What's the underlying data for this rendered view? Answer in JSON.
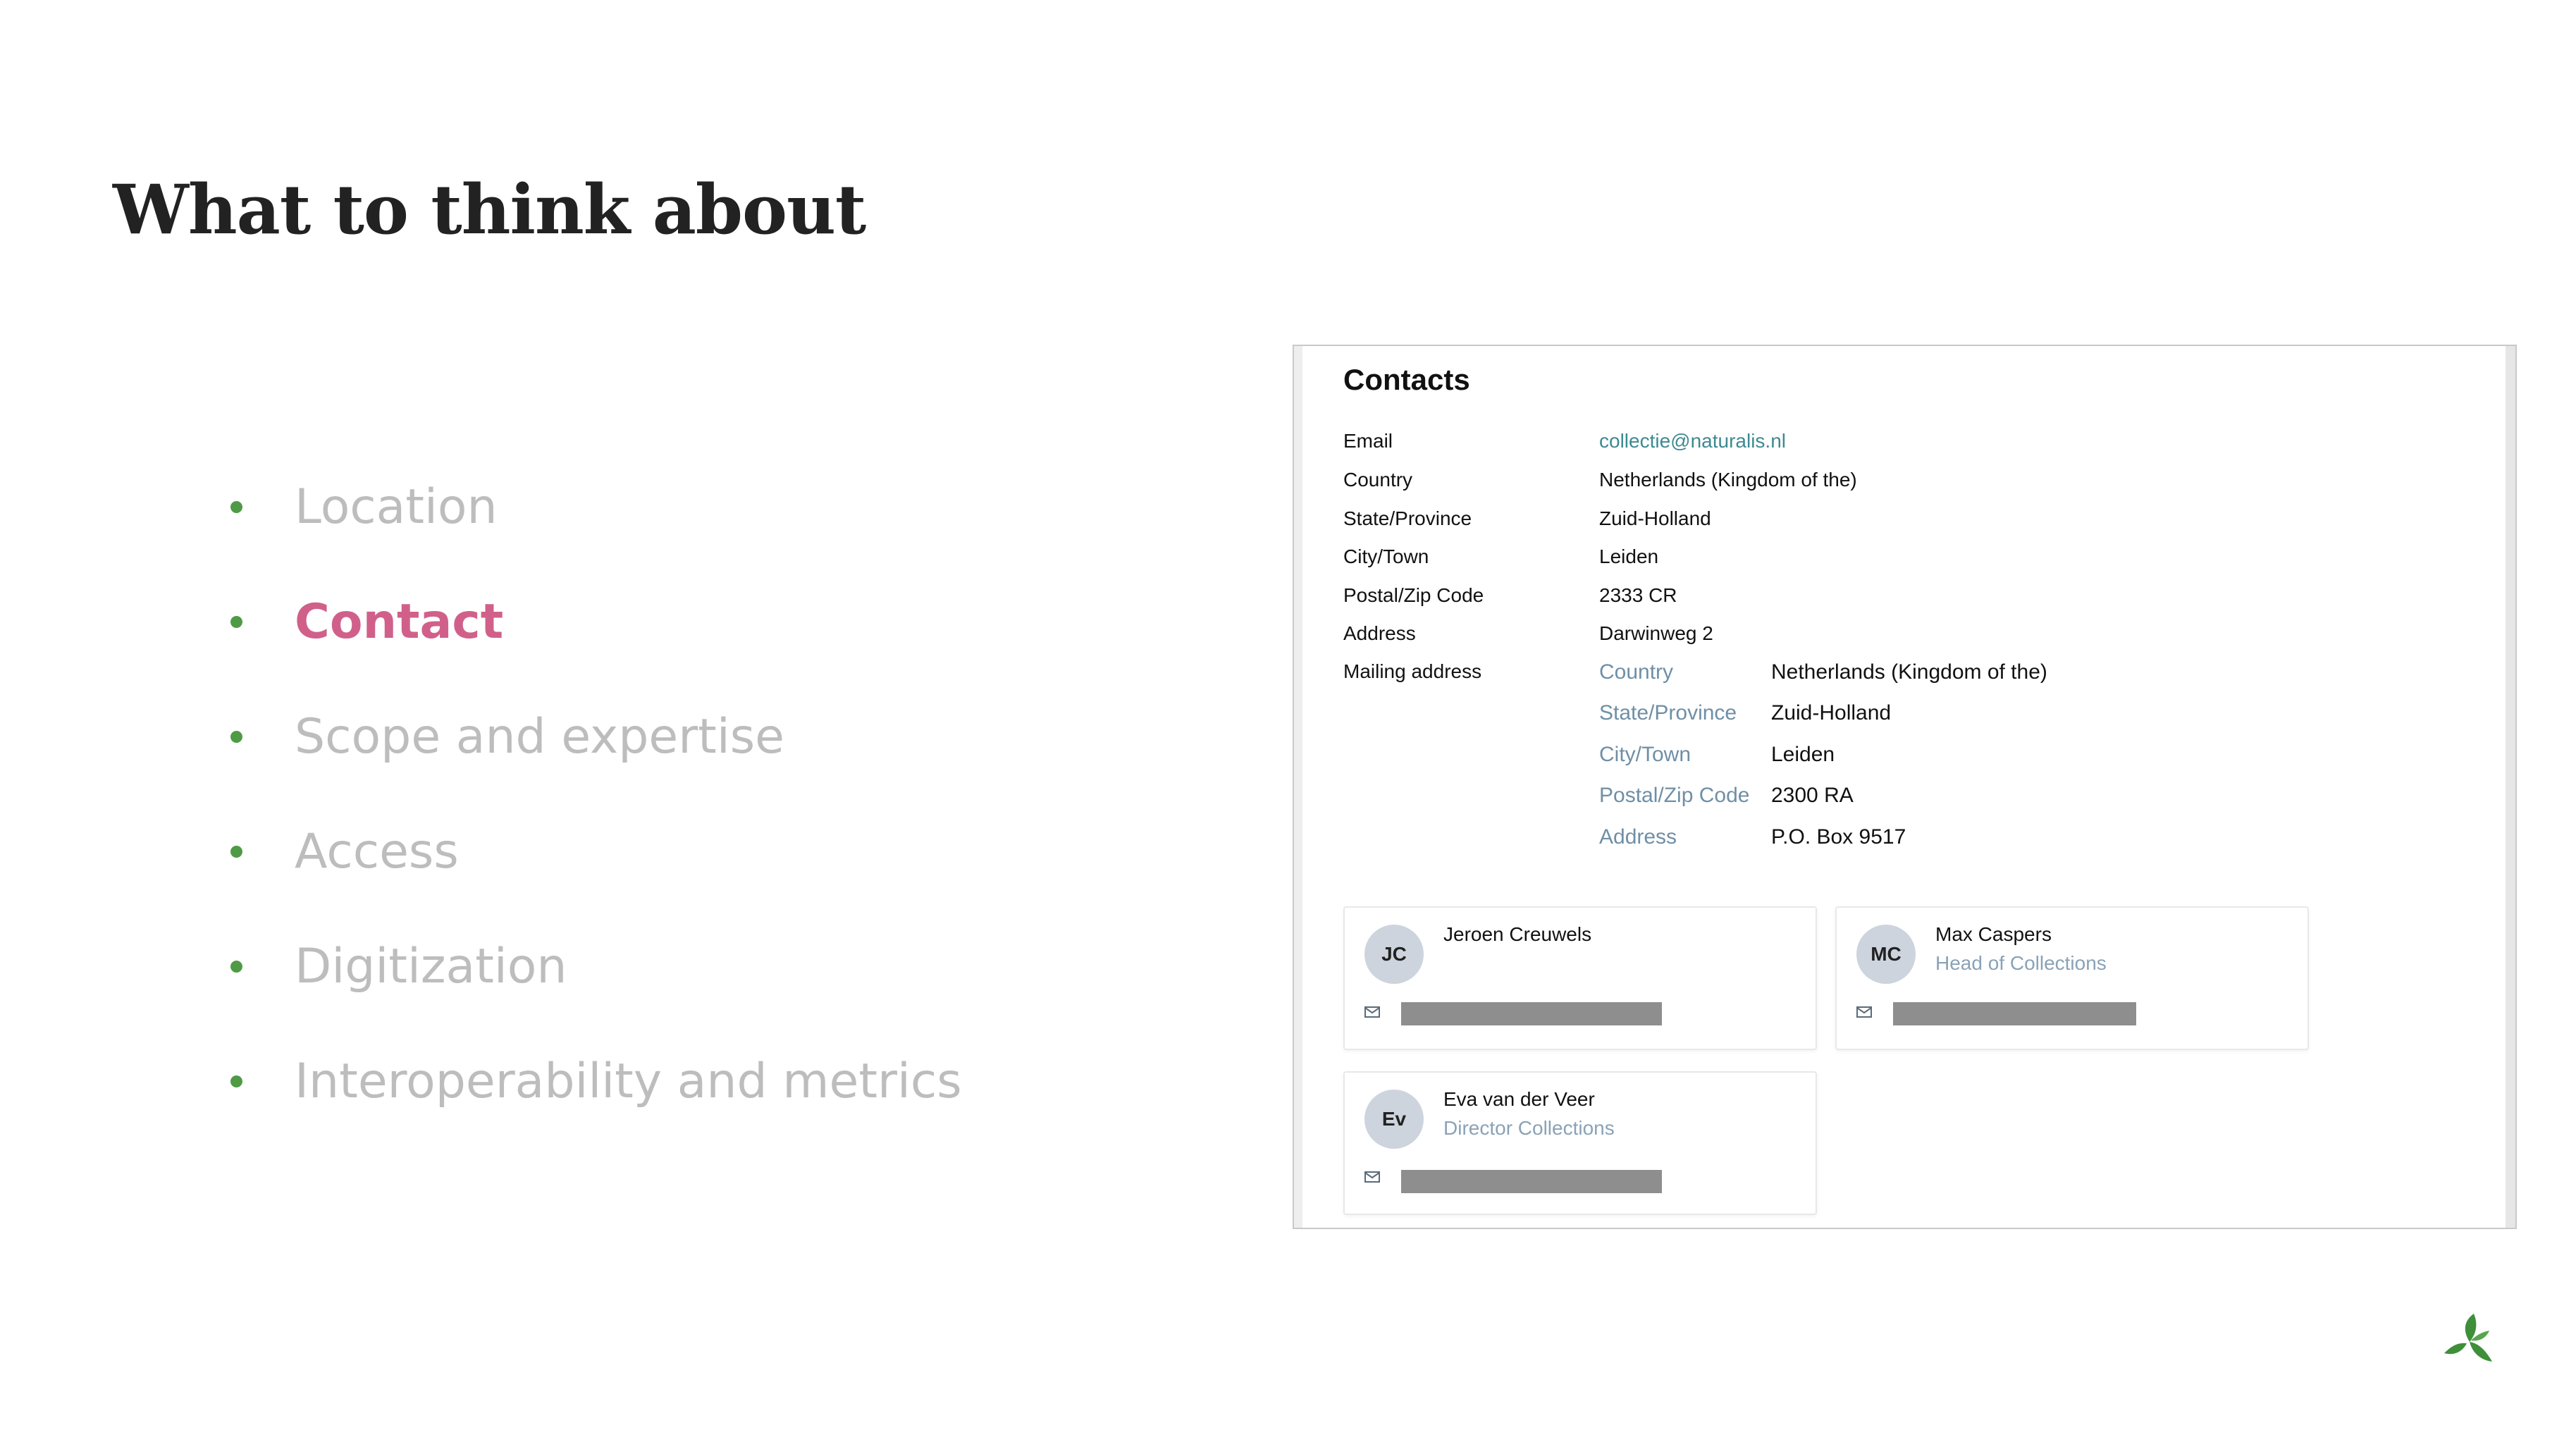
{
  "slide": {
    "title": "What to think about",
    "bullets": [
      {
        "label": "Location",
        "active": false
      },
      {
        "label": "Contact",
        "active": true
      },
      {
        "label": "Scope and expertise",
        "active": false
      },
      {
        "label": "Access",
        "active": false
      },
      {
        "label": "Digitization",
        "active": false
      },
      {
        "label": "Interoperability and metrics",
        "active": false
      }
    ],
    "colors": {
      "bullet_dot": "#4f9a45",
      "inactive_text": "#bdbdbd",
      "active_text": "#d0608a"
    }
  },
  "contacts": {
    "title": "Contacts",
    "rows": [
      {
        "label": "Email",
        "value": "collectie@naturalis.nl"
      },
      {
        "label": "Country",
        "value": "Netherlands (Kingdom of the)"
      },
      {
        "label": "State/Province",
        "value": "Zuid-Holland"
      },
      {
        "label": "City/Town",
        "value": "Leiden"
      },
      {
        "label": "Postal/Zip Code",
        "value": "2333 CR"
      },
      {
        "label": "Address",
        "value": "Darwinweg 2"
      },
      {
        "label": "Mailing address",
        "value": ""
      }
    ],
    "mailing_address": [
      {
        "label": "Country",
        "value": "Netherlands (Kingdom of the)"
      },
      {
        "label": "State/Province",
        "value": "Zuid-Holland"
      },
      {
        "label": "City/Town",
        "value": "Leiden"
      },
      {
        "label": "Postal/Zip Code",
        "value": "2300 RA"
      },
      {
        "label": "Address",
        "value": "P.O. Box 9517"
      }
    ],
    "people": [
      {
        "initials": "JC",
        "name": "Jeroen Creuwels",
        "role": ""
      },
      {
        "initials": "MC",
        "name": "Max Caspers",
        "role": "Head of Collections"
      },
      {
        "initials": "Ev",
        "name": "Eva van der Veer",
        "role": "Director Collections"
      }
    ],
    "icons": {
      "email": "mail-icon",
      "logo": "leaf-logo-icon"
    }
  }
}
